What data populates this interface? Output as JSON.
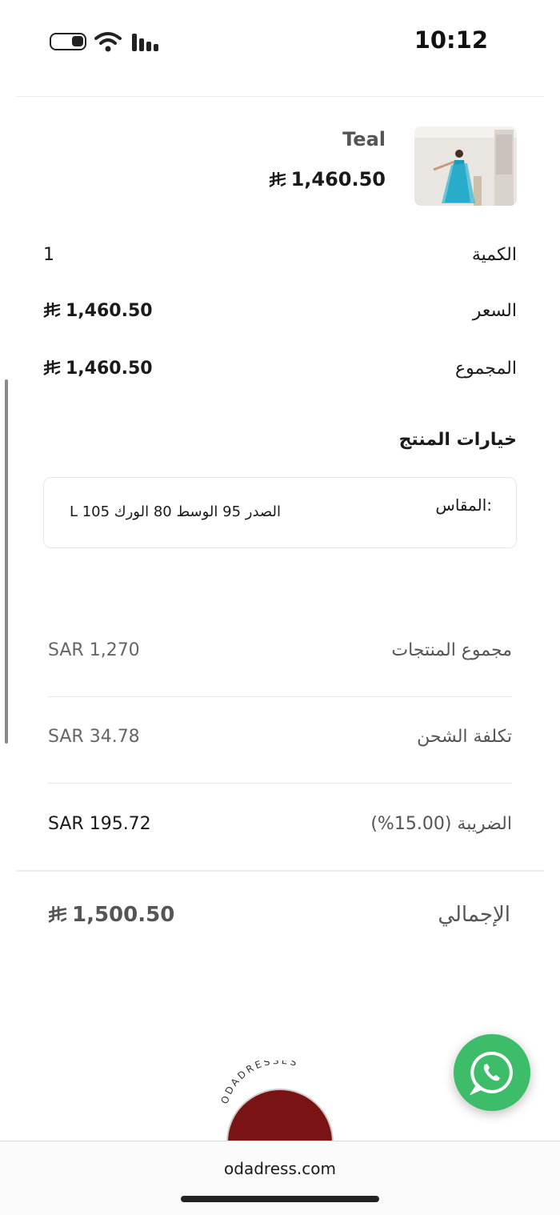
{
  "status": {
    "time": "10:12"
  },
  "product": {
    "color": "Teal",
    "price": "1,460.50"
  },
  "details": [
    {
      "label": "الكمية",
      "value": "1"
    },
    {
      "label": "السعر",
      "value": "1,460.50"
    },
    {
      "label": "المجموع",
      "value": "1,460.50"
    }
  ],
  "options": {
    "title": "خيارات المنتج",
    "size_label": "المقاس:",
    "size_value": "L الصدر 95 الوسط 80 الورك 105"
  },
  "summary": [
    {
      "label": "مجموع المنتجات",
      "value": "SAR 1,270"
    },
    {
      "label": "تكلفة الشحن",
      "value": "SAR 34.78"
    },
    {
      "label": "الضريبة (15.00%)",
      "value": "SAR 195.72"
    }
  ],
  "total": {
    "label": "الإجمالي",
    "value": "1,500.50"
  },
  "logo_text": "ODADRESSES",
  "url": "odadress.com",
  "colors": {
    "whatsapp": "#3dbd6a",
    "logo": "#7a1414",
    "dress": "#1a9bb8"
  }
}
